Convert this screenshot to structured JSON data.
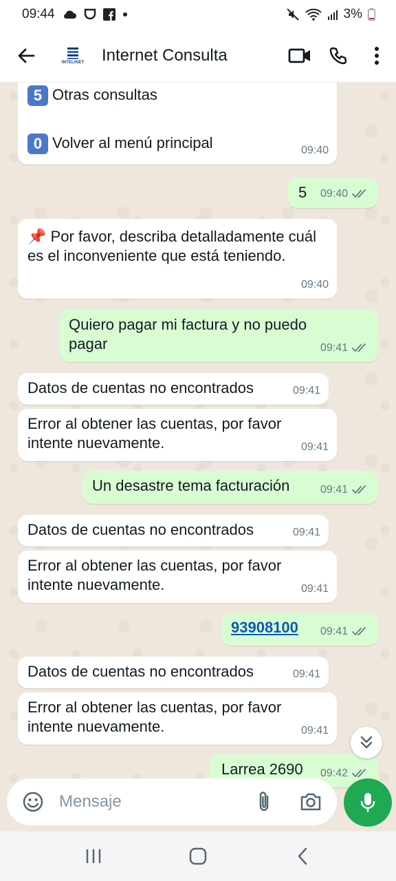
{
  "status_bar": {
    "time": "09:44",
    "battery": "3%"
  },
  "header": {
    "contact_name": "Internet Consulta",
    "avatar_text": "INTELINET"
  },
  "messages": [
    {
      "id": "m1",
      "dir": "in",
      "badge": "5",
      "text": "Otras consultas",
      "badge2": "0",
      "text2": "Volver al menú principal",
      "time": "09:40"
    },
    {
      "id": "m2",
      "dir": "out",
      "text": "5",
      "time": "09:40"
    },
    {
      "id": "m3",
      "dir": "in",
      "emoji": "📌",
      "text": "Por favor, describa detalladamente cuál es el inconveniente que está teniendo.",
      "time": "09:40"
    },
    {
      "id": "m4",
      "dir": "out",
      "text": "Quiero pagar mi factura y no puedo pagar",
      "time": "09:41"
    },
    {
      "id": "m5",
      "dir": "in",
      "text": "Datos de cuentas no encontrados",
      "time": "09:41"
    },
    {
      "id": "m6",
      "dir": "in",
      "text": "Error al obtener las cuentas, por favor intente nuevamente.",
      "time": "09:41"
    },
    {
      "id": "m7",
      "dir": "out",
      "text": "Un desastre tema facturación",
      "time": "09:41"
    },
    {
      "id": "m8",
      "dir": "in",
      "text": "Datos de cuentas no encontrados",
      "time": "09:41"
    },
    {
      "id": "m9",
      "dir": "in",
      "text": "Error al obtener las cuentas, por favor intente nuevamente.",
      "time": "09:41"
    },
    {
      "id": "m10",
      "dir": "out",
      "text": "93908100",
      "time": "09:41"
    },
    {
      "id": "m11",
      "dir": "in",
      "text": "Datos de cuentas no encontrados",
      "time": "09:41"
    },
    {
      "id": "m12",
      "dir": "in",
      "text": "Error al obtener las cuentas, por favor intente nuevamente.",
      "time": "09:41"
    },
    {
      "id": "m13",
      "dir": "out",
      "text": "Larrea 2690",
      "time": "09:42"
    }
  ],
  "composer": {
    "placeholder": "Mensaje"
  },
  "colors": {
    "incoming_bubble": "#ffffff",
    "outgoing_bubble": "#d9fdd3",
    "chat_background": "#efe7dd",
    "accent_green": "#1ea952",
    "link": "#0b5ab8"
  },
  "icons": [
    "back-arrow-icon",
    "video-call-icon",
    "phone-icon",
    "more-options-icon",
    "emoji-icon",
    "attach-icon",
    "camera-icon",
    "mic-icon",
    "double-check-icon",
    "chevron-double-down-icon",
    "recents-icon",
    "home-icon",
    "nav-back-icon"
  ]
}
